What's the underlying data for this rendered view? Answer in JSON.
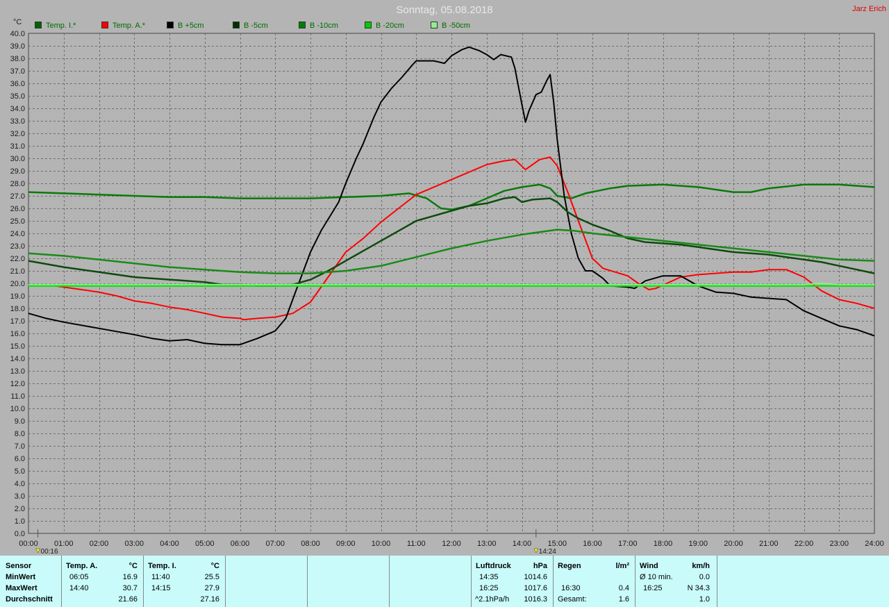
{
  "header": {
    "title": "Sonntag, 05.08.2018",
    "author": "Jarz Erich",
    "y_unit": "°C"
  },
  "legend": [
    {
      "label": "Temp. I.*",
      "color": "#006400"
    },
    {
      "label": "Temp. A.*",
      "color": "#ff0000"
    },
    {
      "label": "B +5cm",
      "color": "#000000"
    },
    {
      "label": "B -5cm",
      "color": "#003000"
    },
    {
      "label": "B -10cm",
      "color": "#008000"
    },
    {
      "label": "B -20cm",
      "color": "#00cc00"
    },
    {
      "label": "B -50cm",
      "color": "#90ee90"
    }
  ],
  "markers": {
    "min_time": "00:16",
    "max_time": "14:24"
  },
  "chart_data": {
    "type": "line",
    "x_unit": "hour",
    "xlim": [
      0,
      24
    ],
    "ylim": [
      0,
      40
    ],
    "y_ticks": [
      "0.0",
      "1.0",
      "2.0",
      "3.0",
      "4.0",
      "5.0",
      "6.0",
      "7.0",
      "8.0",
      "9.0",
      "10.0",
      "11.0",
      "12.0",
      "13.0",
      "14.0",
      "15.0",
      "16.0",
      "17.0",
      "18.0",
      "19.0",
      "20.0",
      "21.0",
      "22.0",
      "23.0",
      "24.0",
      "25.0",
      "26.0",
      "27.0",
      "28.0",
      "29.0",
      "30.0",
      "31.0",
      "32.0",
      "33.0",
      "34.0",
      "35.0",
      "36.0",
      "37.0",
      "38.0",
      "39.0",
      "40.0"
    ],
    "x_ticks": [
      "00:00",
      "01:00",
      "02:00",
      "03:00",
      "04:00",
      "05:00",
      "06:00",
      "07:00",
      "08:00",
      "09:00",
      "10:00",
      "11:00",
      "12:00",
      "13:00",
      "14:00",
      "15:00",
      "16:00",
      "17:00",
      "18:00",
      "19:00",
      "20:00",
      "21:00",
      "22:00",
      "23:00",
      "24:00"
    ],
    "grid": true,
    "legend_position": "top",
    "series": [
      {
        "name": "Temp. I.*",
        "color": "#0a7a0a",
        "width": 2.5,
        "points": [
          [
            0,
            27.3
          ],
          [
            1,
            27.2
          ],
          [
            2,
            27.1
          ],
          [
            3,
            27.0
          ],
          [
            4,
            26.9
          ],
          [
            5,
            26.9
          ],
          [
            6,
            26.8
          ],
          [
            7,
            26.8
          ],
          [
            8,
            26.8
          ],
          [
            9,
            26.9
          ],
          [
            10,
            27.0
          ],
          [
            10.8,
            27.2
          ],
          [
            11.3,
            26.8
          ],
          [
            11.7,
            26.0
          ],
          [
            12,
            25.9
          ],
          [
            12.5,
            26.2
          ],
          [
            13,
            26.8
          ],
          [
            13.5,
            27.4
          ],
          [
            14,
            27.7
          ],
          [
            14.5,
            27.9
          ],
          [
            14.8,
            27.6
          ],
          [
            15,
            27.0
          ],
          [
            15.4,
            26.8
          ],
          [
            15.8,
            27.2
          ],
          [
            16.5,
            27.6
          ],
          [
            17,
            27.8
          ],
          [
            18,
            27.9
          ],
          [
            19,
            27.7
          ],
          [
            19.5,
            27.5
          ],
          [
            20,
            27.3
          ],
          [
            20.5,
            27.3
          ],
          [
            21,
            27.6
          ],
          [
            22,
            27.9
          ],
          [
            23,
            27.9
          ],
          [
            24,
            27.7
          ]
        ]
      },
      {
        "name": "Temp. A.*",
        "color": "#ff0000",
        "width": 2,
        "points": [
          [
            0,
            19.8
          ],
          [
            0.5,
            19.9
          ],
          [
            1,
            19.7
          ],
          [
            2,
            19.3
          ],
          [
            2.5,
            19.0
          ],
          [
            3,
            18.6
          ],
          [
            3.5,
            18.4
          ],
          [
            4,
            18.1
          ],
          [
            4.5,
            17.9
          ],
          [
            5,
            17.6
          ],
          [
            5.5,
            17.3
          ],
          [
            6,
            17.2
          ],
          [
            6.1,
            17.1
          ],
          [
            6.5,
            17.2
          ],
          [
            7,
            17.3
          ],
          [
            7.5,
            17.6
          ],
          [
            8,
            18.5
          ],
          [
            8.5,
            20.5
          ],
          [
            9,
            22.5
          ],
          [
            9.5,
            23.6
          ],
          [
            10,
            24.9
          ],
          [
            10.5,
            26.0
          ],
          [
            11,
            27.1
          ],
          [
            11.5,
            27.7
          ],
          [
            12,
            28.3
          ],
          [
            12.5,
            28.9
          ],
          [
            13,
            29.5
          ],
          [
            13.5,
            29.8
          ],
          [
            13.8,
            29.9
          ],
          [
            14.1,
            29.1
          ],
          [
            14.5,
            29.9
          ],
          [
            14.8,
            30.1
          ],
          [
            15.0,
            29.4
          ],
          [
            15.3,
            27.3
          ],
          [
            15.6,
            25.0
          ],
          [
            16,
            22.0
          ],
          [
            16.3,
            21.2
          ],
          [
            17,
            20.6
          ],
          [
            17.3,
            20.0
          ],
          [
            17.6,
            19.5
          ],
          [
            17.8,
            19.6
          ],
          [
            18.5,
            20.5
          ],
          [
            19,
            20.7
          ],
          [
            20,
            20.9
          ],
          [
            20.5,
            20.9
          ],
          [
            21,
            21.1
          ],
          [
            21.5,
            21.1
          ],
          [
            22,
            20.5
          ],
          [
            22.5,
            19.4
          ],
          [
            23,
            18.7
          ],
          [
            23.5,
            18.4
          ],
          [
            24,
            18.0
          ]
        ]
      },
      {
        "name": "B +5cm",
        "color": "#000000",
        "width": 2,
        "points": [
          [
            0,
            17.6
          ],
          [
            0.5,
            17.2
          ],
          [
            1,
            16.9
          ],
          [
            2,
            16.4
          ],
          [
            3,
            15.9
          ],
          [
            3.5,
            15.6
          ],
          [
            4,
            15.4
          ],
          [
            4.5,
            15.5
          ],
          [
            5,
            15.2
          ],
          [
            5.5,
            15.1
          ],
          [
            6,
            15.1
          ],
          [
            6.5,
            15.6
          ],
          [
            7,
            16.2
          ],
          [
            7.3,
            17.2
          ],
          [
            7.6,
            19.5
          ],
          [
            7.8,
            21.0
          ],
          [
            8,
            22.5
          ],
          [
            8.3,
            24.2
          ],
          [
            8.8,
            26.5
          ],
          [
            9,
            28.0
          ],
          [
            9.3,
            30.0
          ],
          [
            9.5,
            31.2
          ],
          [
            9.8,
            33.3
          ],
          [
            10,
            34.5
          ],
          [
            10.3,
            35.6
          ],
          [
            10.6,
            36.5
          ],
          [
            10.9,
            37.5
          ],
          [
            11,
            37.8
          ],
          [
            11.2,
            37.8
          ],
          [
            11.5,
            37.8
          ],
          [
            11.8,
            37.6
          ],
          [
            12,
            38.2
          ],
          [
            12.3,
            38.7
          ],
          [
            12.5,
            38.9
          ],
          [
            12.8,
            38.6
          ],
          [
            13,
            38.3
          ],
          [
            13.2,
            37.9
          ],
          [
            13.4,
            38.3
          ],
          [
            13.7,
            38.1
          ],
          [
            13.8,
            37.2
          ],
          [
            14,
            34.3
          ],
          [
            14.1,
            32.9
          ],
          [
            14.2,
            33.8
          ],
          [
            14.4,
            35.1
          ],
          [
            14.55,
            35.3
          ],
          [
            14.7,
            36.2
          ],
          [
            14.8,
            36.7
          ],
          [
            14.9,
            34.5
          ],
          [
            15.0,
            31.5
          ],
          [
            15.2,
            27.0
          ],
          [
            15.4,
            24.0
          ],
          [
            15.6,
            22.0
          ],
          [
            15.8,
            21.0
          ],
          [
            16,
            21.0
          ],
          [
            16.3,
            20.4
          ],
          [
            16.5,
            19.8
          ],
          [
            17,
            19.7
          ],
          [
            17.2,
            19.6
          ],
          [
            17.5,
            20.2
          ],
          [
            18,
            20.6
          ],
          [
            18.5,
            20.6
          ],
          [
            19,
            19.8
          ],
          [
            19.5,
            19.3
          ],
          [
            20,
            19.2
          ],
          [
            20.5,
            18.9
          ],
          [
            21,
            18.8
          ],
          [
            21.5,
            18.7
          ],
          [
            22,
            17.8
          ],
          [
            22.5,
            17.2
          ],
          [
            23,
            16.6
          ],
          [
            23.5,
            16.3
          ],
          [
            24,
            15.8
          ]
        ]
      },
      {
        "name": "B -5cm",
        "color": "#0d4a0d",
        "width": 2.5,
        "points": [
          [
            0,
            21.8
          ],
          [
            1,
            21.3
          ],
          [
            2,
            20.9
          ],
          [
            3,
            20.5
          ],
          [
            4,
            20.3
          ],
          [
            5,
            20.1
          ],
          [
            5.5,
            19.9
          ],
          [
            6,
            19.9
          ],
          [
            6.5,
            19.8
          ],
          [
            7,
            19.8
          ],
          [
            7.5,
            19.9
          ],
          [
            8,
            20.3
          ],
          [
            8.5,
            21.0
          ],
          [
            9,
            21.8
          ],
          [
            9.5,
            22.6
          ],
          [
            10,
            23.4
          ],
          [
            10.5,
            24.2
          ],
          [
            11,
            25.0
          ],
          [
            11.5,
            25.4
          ],
          [
            12,
            25.8
          ],
          [
            12.5,
            26.2
          ],
          [
            13,
            26.4
          ],
          [
            13.5,
            26.8
          ],
          [
            13.8,
            26.9
          ],
          [
            14.0,
            26.5
          ],
          [
            14.3,
            26.7
          ],
          [
            14.8,
            26.8
          ],
          [
            15.0,
            26.5
          ],
          [
            15.3,
            25.7
          ],
          [
            15.6,
            25.2
          ],
          [
            16,
            24.7
          ],
          [
            16.5,
            24.2
          ],
          [
            17,
            23.6
          ],
          [
            17.5,
            23.3
          ],
          [
            18,
            23.2
          ],
          [
            18.5,
            23.1
          ],
          [
            19,
            22.9
          ],
          [
            19.5,
            22.7
          ],
          [
            20,
            22.5
          ],
          [
            20.5,
            22.4
          ],
          [
            21,
            22.3
          ],
          [
            21.5,
            22.1
          ],
          [
            22,
            21.9
          ],
          [
            22.5,
            21.7
          ],
          [
            23,
            21.4
          ],
          [
            23.5,
            21.1
          ],
          [
            24,
            20.8
          ]
        ]
      },
      {
        "name": "B -10cm",
        "color": "#1a8a1a",
        "width": 2.5,
        "points": [
          [
            0,
            22.4
          ],
          [
            1,
            22.2
          ],
          [
            2,
            21.9
          ],
          [
            3,
            21.6
          ],
          [
            4,
            21.3
          ],
          [
            5,
            21.1
          ],
          [
            6,
            20.9
          ],
          [
            7,
            20.8
          ],
          [
            8,
            20.8
          ],
          [
            9,
            21.0
          ],
          [
            10,
            21.4
          ],
          [
            11,
            22.1
          ],
          [
            12,
            22.8
          ],
          [
            13,
            23.4
          ],
          [
            14,
            23.9
          ],
          [
            15,
            24.3
          ],
          [
            15.5,
            24.2
          ],
          [
            16,
            24.0
          ],
          [
            17,
            23.7
          ],
          [
            18,
            23.4
          ],
          [
            19,
            23.1
          ],
          [
            20,
            22.8
          ],
          [
            21,
            22.5
          ],
          [
            22,
            22.2
          ],
          [
            23,
            21.9
          ],
          [
            24,
            21.8
          ]
        ]
      },
      {
        "name": "B -20cm",
        "color": "#11dd11",
        "width": 2.5,
        "points": [
          [
            0,
            19.8
          ],
          [
            4,
            19.8
          ],
          [
            8,
            19.8
          ],
          [
            12,
            19.8
          ],
          [
            16,
            19.8
          ],
          [
            20,
            19.8
          ],
          [
            23,
            19.8
          ],
          [
            24,
            19.8
          ]
        ]
      },
      {
        "name": "B -50cm",
        "color": "#90ee90",
        "width": 2,
        "points": [
          [
            0,
            19.9
          ],
          [
            5,
            19.9
          ],
          [
            10,
            19.9
          ],
          [
            15,
            19.9
          ],
          [
            20,
            19.9
          ],
          [
            22,
            19.9
          ],
          [
            22.5,
            20.0
          ],
          [
            23,
            19.9
          ],
          [
            24,
            19.9
          ]
        ]
      }
    ]
  },
  "stats": {
    "sensor_label": "Sensor",
    "row_labels": [
      "MinWert",
      "MaxWert",
      "Durchschnitt"
    ],
    "temp_a": {
      "title": "Temp. A.",
      "unit": "°C",
      "min_time": "06:05",
      "min_val": "16.9",
      "max_time": "14:40",
      "max_val": "30.7",
      "avg": "21.66"
    },
    "temp_i": {
      "title": "Temp. I.",
      "unit": "°C",
      "min_time": "11:40",
      "min_val": "25.5",
      "max_time": "14:15",
      "max_val": "27.9",
      "avg": "27.16"
    },
    "pressure": {
      "title": "Luftdruck",
      "unit": "hPa",
      "min_time": "14:35",
      "min_val": "1014.6",
      "max_time": "16:25",
      "max_val": "1017.6",
      "trend": "^2.1hPa/h",
      "avg": "1016.3"
    },
    "rain": {
      "title": "Regen",
      "unit": "l/m²",
      "max_time": "16:30",
      "max_val": "0.4",
      "total_label": "Gesamt:",
      "total": "1.6"
    },
    "wind": {
      "title": "Wind",
      "unit": "km/h",
      "min_label": "Ø 10 min.",
      "min_val": "0.0",
      "max_time": "16:25",
      "max_val": "N 34.3",
      "avg": "1.0"
    }
  }
}
